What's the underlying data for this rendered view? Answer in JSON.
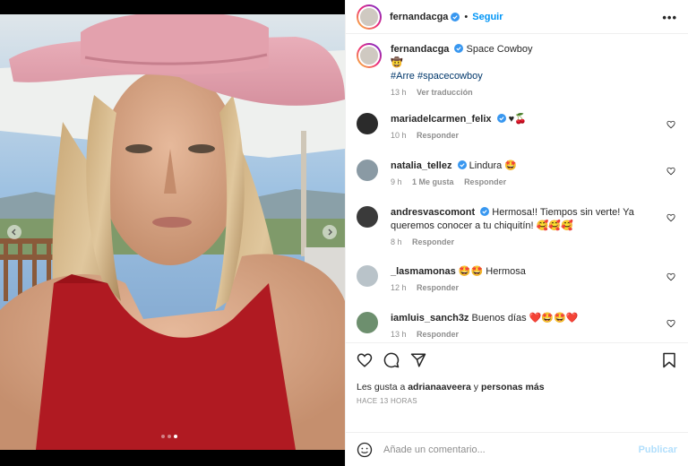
{
  "post": {
    "author": "fernandacga",
    "follow_label": "Seguir",
    "separator": "•",
    "more_label": "•••",
    "caption": {
      "title": "Space Cowboy",
      "emoji": "🤠",
      "hashtags": [
        "#Arre",
        "#spacecowboy"
      ],
      "time": "13 h",
      "translate_label": "Ver traducción"
    },
    "comments": [
      {
        "user": "mariadelcarmen_felix",
        "verified": true,
        "text": "♥🍒",
        "time": "10 h",
        "likes": "",
        "reply": "Responder"
      },
      {
        "user": "natalia_tellez",
        "verified": true,
        "text": "Lindura 🤩",
        "time": "9 h",
        "likes": "1 Me gusta",
        "reply": "Responder"
      },
      {
        "user": "andresvascomont",
        "verified": true,
        "text": "Hermosa!! Tiempos sin verte! Ya queremos conocer a tu chiquitín! 🥰🥰🥰",
        "time": "8 h",
        "likes": "",
        "reply": "Responder"
      },
      {
        "user": "_lasmamonas",
        "verified": false,
        "text": "🤩🤩 Hermosa",
        "time": "12 h",
        "likes": "",
        "reply": "Responder"
      },
      {
        "user": "iamluis_sanch3z",
        "verified": false,
        "text": "Buenos días ❤️🤩🤩❤️",
        "time": "13 h",
        "likes": "",
        "reply": "Responder"
      }
    ],
    "likes_prefix": "Les gusta a",
    "likes_user": "adrianaaveera",
    "likes_and": "y",
    "likes_others": "personas más",
    "posted_ago": "HACE 13 HORAS",
    "comment_placeholder": "Añade un comentario...",
    "publish_label": "Publicar",
    "carousel": {
      "count": 3,
      "active": 2
    }
  },
  "colors": {
    "link_blue": "#0095f6",
    "publish_disabled": "#b2dffc",
    "hashtag": "#00376b",
    "verified": "#3897f0"
  },
  "icons": [
    "verified-icon",
    "more-icon",
    "heart-icon",
    "comment-icon",
    "share-icon",
    "bookmark-icon",
    "emoji-icon",
    "chevron-left-icon",
    "chevron-right-icon"
  ]
}
